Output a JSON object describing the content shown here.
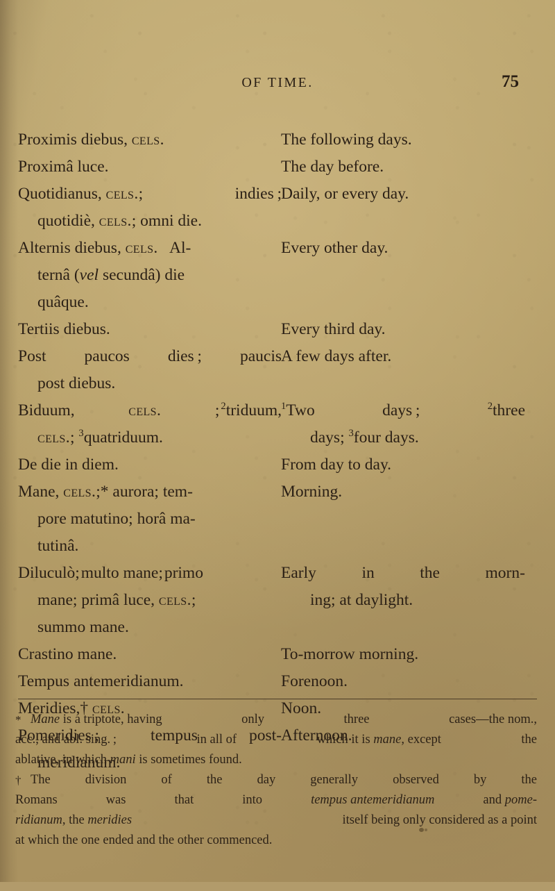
{
  "page": {
    "running_head": "OF TIME.",
    "folio": "75"
  },
  "entries": [
    {
      "latin_lines": [
        "Proximis diebus, CELS."
      ],
      "english_lines": [
        "The following days."
      ]
    },
    {
      "latin_lines": [
        "Proximâ luce."
      ],
      "english_lines": [
        "The day before."
      ]
    },
    {
      "latin_lines": [
        "Quotidianus, CELS.; indies;",
        "quotidiè, CELS.; omni die."
      ],
      "english_lines": [
        "Daily, or every day."
      ]
    },
    {
      "latin_lines": [
        "Alternis diebus, CELS.  Al-",
        "ternâ (vel secundâ) die",
        "quâque."
      ],
      "english_lines": [
        "Every other day."
      ]
    },
    {
      "latin_lines": [
        "Tertiis diebus."
      ],
      "english_lines": [
        "Every third day."
      ]
    },
    {
      "latin_lines": [
        "Post paucos dies; paucis",
        "post diebus."
      ],
      "english_lines": [
        "A few days after."
      ]
    },
    {
      "latin_lines": [
        "Biduum, CELS.; 2triduum,",
        "CELS.; 3quatriduum."
      ],
      "english_lines": [
        "1Two days; 2three",
        "days; 3four days."
      ]
    },
    {
      "latin_lines": [
        "De die in diem."
      ],
      "english_lines": [
        "From day to day."
      ]
    },
    {
      "latin_lines": [
        "Mane, CELS.;* aurora; tem-",
        "pore matutino; horâ ma-",
        "tutinâ."
      ],
      "english_lines": [
        "Morning."
      ]
    },
    {
      "latin_lines": [
        "Diluculò; multo mane; primo",
        "mane; primâ luce, CELS.;",
        "summo mane."
      ],
      "english_lines": [
        "Early in the morn-",
        "ing; at daylight."
      ]
    },
    {
      "latin_lines": [
        "Crastino mane."
      ],
      "english_lines": [
        "To-morrow morning."
      ]
    },
    {
      "latin_lines": [
        "Tempus antemeridianum."
      ],
      "english_lines": [
        "Forenoon."
      ]
    },
    {
      "latin_lines": [
        "Meridies,† CELS."
      ],
      "english_lines": [
        "Noon."
      ]
    },
    {
      "latin_lines": [
        "Pomeridies; tempus post-",
        "meridianum."
      ],
      "english_lines": [
        "Afternoon."
      ]
    }
  ],
  "footnotes": [
    {
      "marker": "*",
      "lines": [
        "Mane is a triptote, having only three cases—the nom.,",
        "acc., and abl. sing.; in all of which it is mane, except the",
        "ablative, in which mani is sometimes found."
      ]
    },
    {
      "marker": "†",
      "lines": [
        "The division of the day generally observed by the",
        "Romans was that into tempus antemeridianum and pome-",
        "ridianum, the meridies itself being only considered as a point",
        "at which the one ended and the other commenced."
      ]
    }
  ],
  "abbrev": {
    "cels": "Cels."
  },
  "colors": {
    "paper": "#b29b6b",
    "ink": "#2a1f15"
  }
}
